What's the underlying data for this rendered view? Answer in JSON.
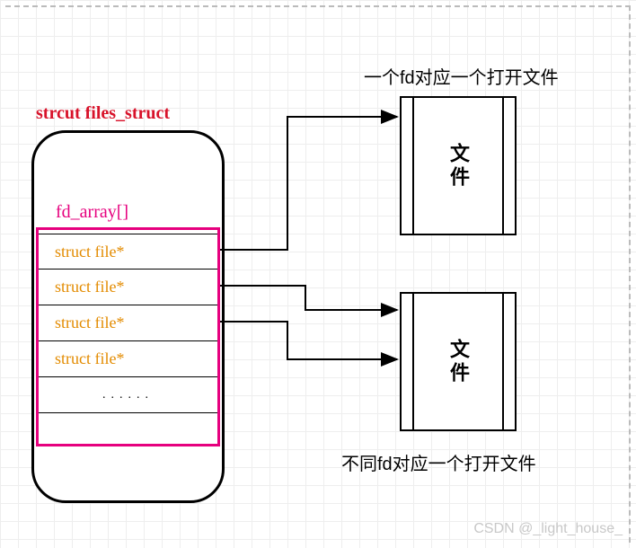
{
  "struct_title": "strcut files_struct",
  "fd_array_label": "fd_array[]",
  "fd_items": {
    "0": "struct file*",
    "1": "struct file*",
    "2": "struct file*",
    "3": "struct file*",
    "dots": "......"
  },
  "file_label_1": "文件",
  "file_label_2": "文件",
  "caption_top": "一个fd对应一个打开文件",
  "caption_bottom": "不同fd对应一个打开文件",
  "watermark": "CSDN @_light_house_"
}
